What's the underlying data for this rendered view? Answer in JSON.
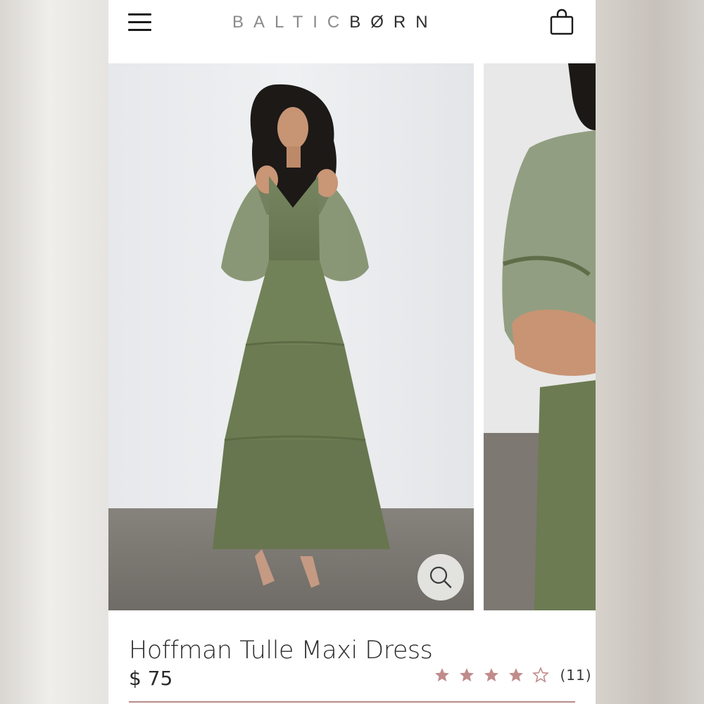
{
  "header": {
    "logo_light": "BALTIC",
    "logo_dark": "BØRN",
    "menu_icon": "hamburger-menu-icon",
    "cart_icon": "shopping-bag-icon"
  },
  "gallery": {
    "images": [
      {
        "description_icon": "product-photo"
      },
      {
        "description_icon": "product-photo"
      }
    ],
    "zoom_icon": "magnifier-icon",
    "wishlist_icon": "heart-icon"
  },
  "product": {
    "name": "Hoffman Tulle Maxi Dress",
    "price": "$ 75",
    "rating": 4,
    "rating_max": 5,
    "review_count": "(11)"
  },
  "colors": {
    "dress_green": "#6f7f5c",
    "star_color": "#c08c8b",
    "text": "#2b2b2b"
  }
}
